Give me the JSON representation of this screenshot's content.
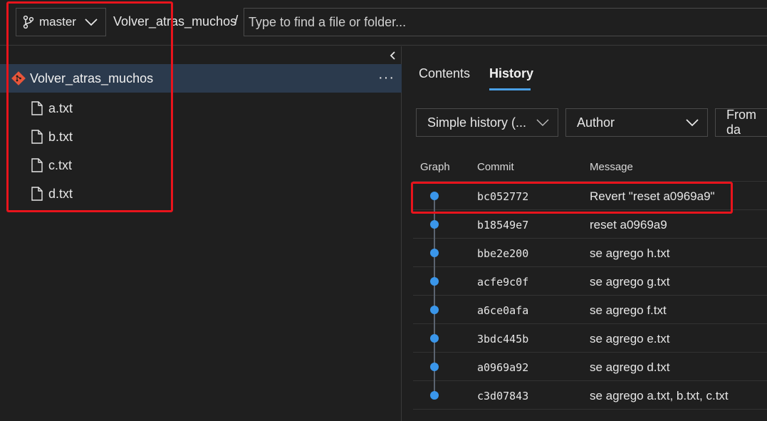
{
  "topbar": {
    "branch": "master",
    "repo": "Volver_atras_muchos",
    "separator": "/",
    "search_placeholder": "Type to find a file or folder..."
  },
  "tree": {
    "repo": "Volver_atras_muchos",
    "more": "···",
    "files": [
      "a.txt",
      "b.txt",
      "c.txt",
      "d.txt"
    ]
  },
  "tabs": {
    "contents": "Contents",
    "history": "History"
  },
  "filters": {
    "history_mode": "Simple history (...",
    "author": "Author",
    "from_date": "From da"
  },
  "columns": {
    "graph": "Graph",
    "commit": "Commit",
    "message": "Message"
  },
  "commits": [
    {
      "hash": "bc052772",
      "message": "Revert \"reset a0969a9\""
    },
    {
      "hash": "b18549e7",
      "message": "reset a0969a9"
    },
    {
      "hash": "bbe2e200",
      "message": "se agrego h.txt"
    },
    {
      "hash": "acfe9c0f",
      "message": "se agrego g.txt"
    },
    {
      "hash": "a6ce0afa",
      "message": "se agrego f.txt"
    },
    {
      "hash": "3bdc445b",
      "message": "se agrego e.txt"
    },
    {
      "hash": "a0969a92",
      "message": "se agrego d.txt"
    },
    {
      "hash": "c3d07843",
      "message": "se agrego a.txt, b.txt, c.txt"
    }
  ],
  "colors": {
    "accent": "#3a96ea",
    "highlight": "#e8141c",
    "selected_row": "#2b3a4d",
    "git_logo": "#e8553a"
  }
}
